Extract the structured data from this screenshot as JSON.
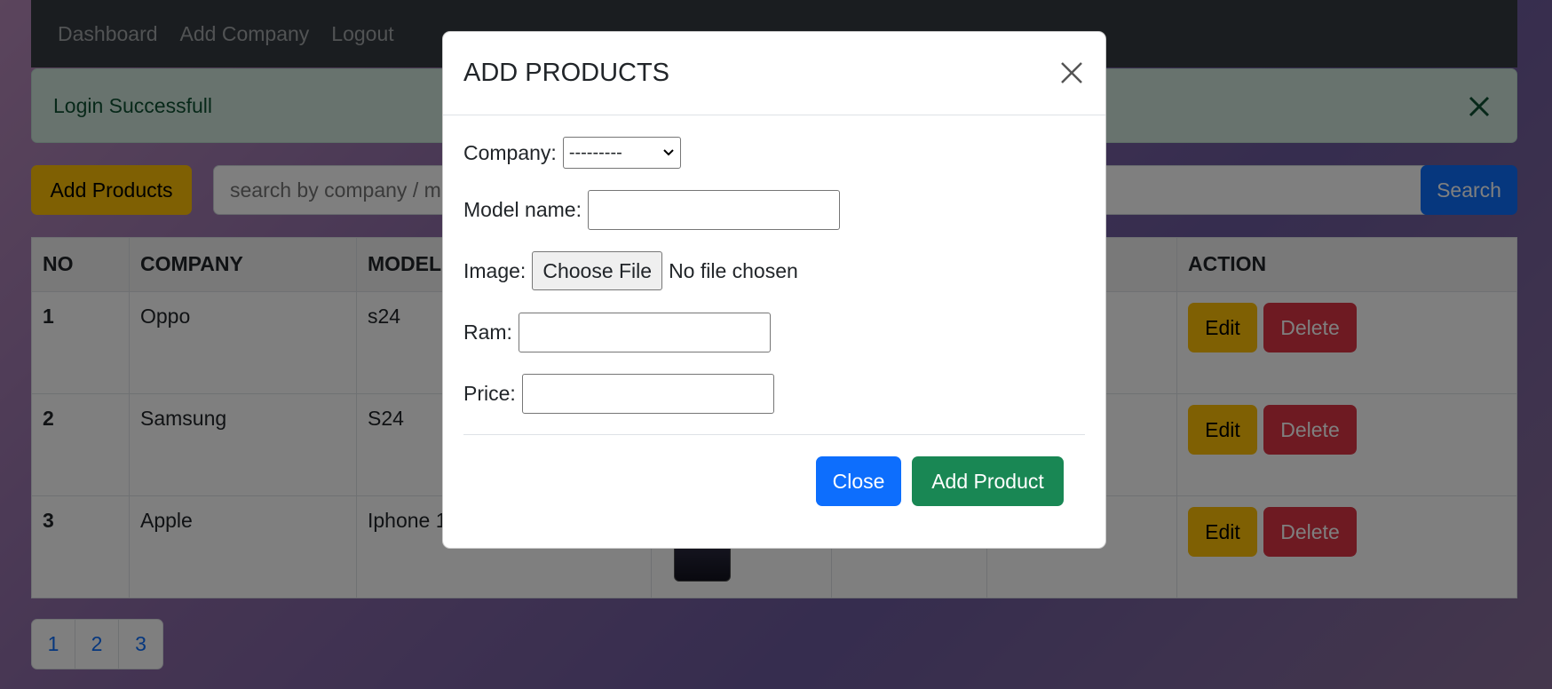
{
  "nav": {
    "links": [
      "Dashboard",
      "Add Company",
      "Logout"
    ]
  },
  "alert": {
    "message": "Login Successfull"
  },
  "toolbar": {
    "add_products_label": "Add Products",
    "search_placeholder": "search by company / m",
    "search_button_label": "Search"
  },
  "table": {
    "headers": [
      "NO",
      "COMPANY",
      "MODEL",
      "",
      "",
      "",
      "ACTION"
    ],
    "rows": [
      {
        "no": "1",
        "company": "Oppo",
        "model": "s24"
      },
      {
        "no": "2",
        "company": "Samsung",
        "model": "S24"
      },
      {
        "no": "3",
        "company": "Apple",
        "model": "Iphone 1"
      }
    ],
    "edit_label": "Edit",
    "delete_label": "Delete"
  },
  "pagination": {
    "pages": [
      "1",
      "2",
      "3"
    ]
  },
  "modal": {
    "title": "ADD PRODUCTS",
    "company_label": "Company:",
    "company_selected": "---------",
    "model_label": "Model name:",
    "image_label": "Image:",
    "choose_file_label": "Choose File",
    "file_status": "No file chosen",
    "ram_label": "Ram:",
    "price_label": "Price:",
    "close_label": "Close",
    "submit_label": "Add Product"
  },
  "colors": {
    "warning": "#ffc107",
    "danger": "#dc3545",
    "primary": "#0d6efd",
    "success": "#198754",
    "navbar": "#343a40"
  }
}
